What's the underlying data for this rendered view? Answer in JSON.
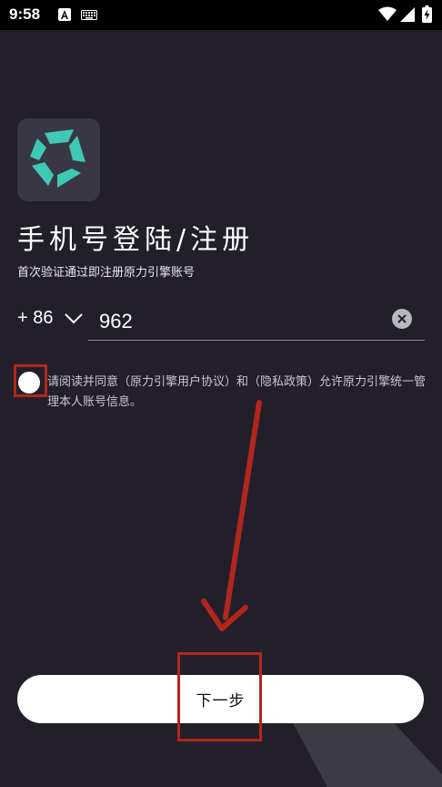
{
  "status_bar": {
    "time": "9:58",
    "icons": [
      "a-notification-icon",
      "keyboard-icon",
      "wifi-icon",
      "signal-icon",
      "battery-charging-icon"
    ]
  },
  "login": {
    "logo_icon": "app-logo-icon",
    "title": "手机号登陆/注册",
    "subtitle": "首次验证通过即注册原力引擎账号",
    "country_code": "+ 86",
    "phone_value": "962",
    "clear_icon": "clear-icon",
    "agreement_text": "请阅读并同意（原力引擎用户协议）和（隐私政策）允许原力引擎统一管理本人账号信息。",
    "agreement_checked": false,
    "next_label": "下一步"
  },
  "colors": {
    "background": "#221f2b",
    "accent_teal": "#3ec9b4",
    "annotation_red": "#b1261c"
  }
}
